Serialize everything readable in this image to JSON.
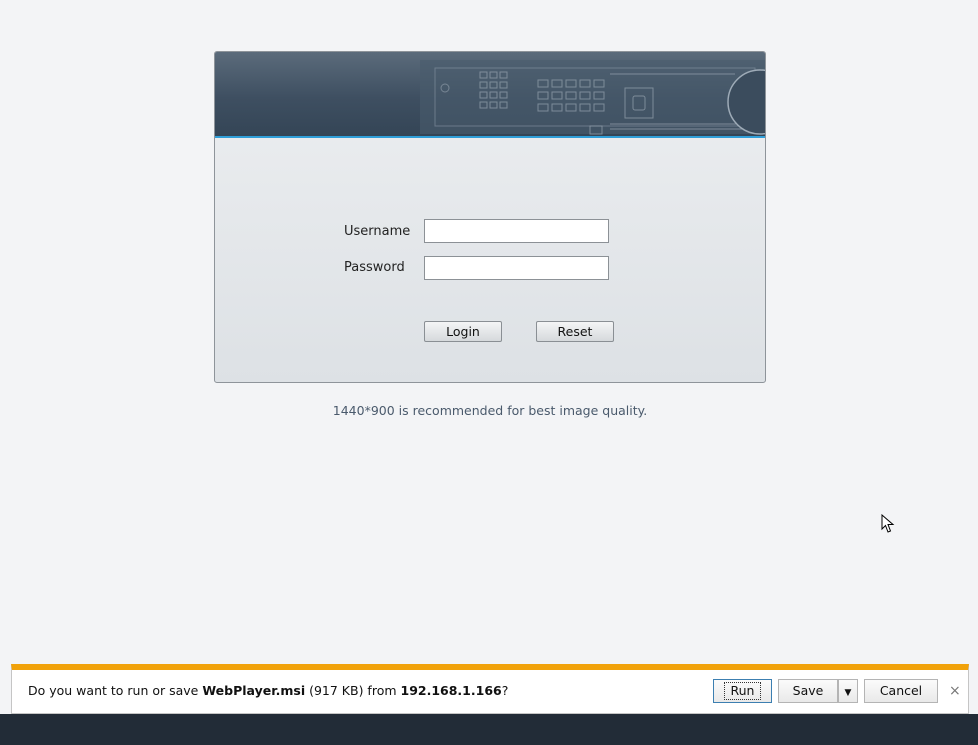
{
  "login": {
    "username_label": "Username",
    "password_label": "Password",
    "username_value": "",
    "password_value": "",
    "login_button": "Login",
    "reset_button": "Reset"
  },
  "hint": "1440*900 is recommended for best image quality.",
  "download_bar": {
    "prefix": "Do you want to run or save ",
    "filename": "WebPlayer.msi",
    "size": " (917 KB) from ",
    "host": "192.168.1.166",
    "suffix": "?",
    "run_label": "Run",
    "save_label": "Save",
    "cancel_label": "Cancel",
    "close_glyph": "×",
    "dropdown_glyph": "▼"
  },
  "colors": {
    "accent_bar": "#f1a20a",
    "banner_line": "#2f9fd9",
    "taskbar": "#222c37"
  },
  "icons": [
    "dvr-device-graphic",
    "mouse-cursor-icon",
    "close-icon",
    "dropdown-arrow-icon"
  ]
}
